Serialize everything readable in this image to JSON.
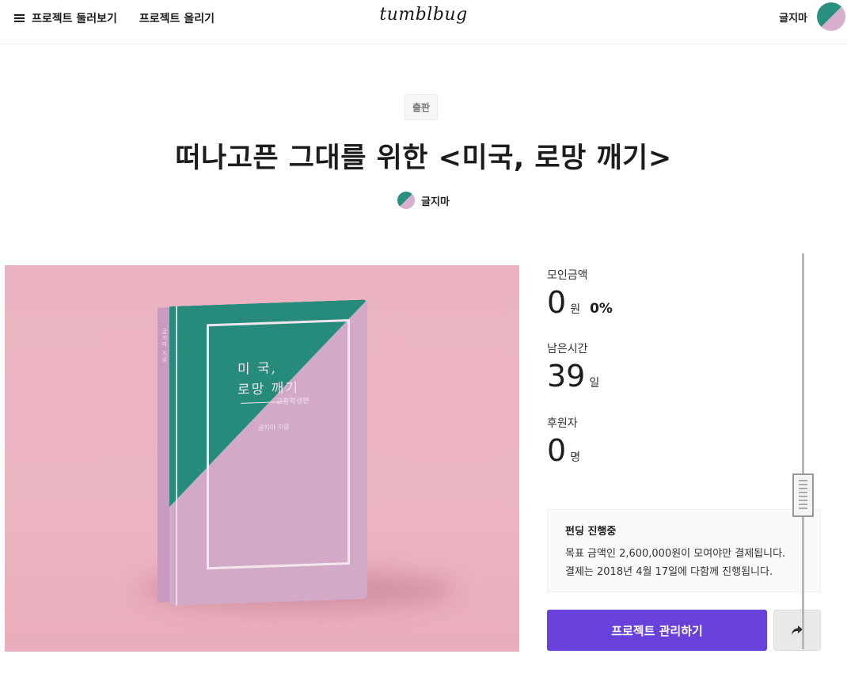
{
  "header": {
    "nav_browse": "프로젝트 둘러보기",
    "nav_upload": "프로젝트 올리기",
    "logo": "tumblbug",
    "user_name": "글지마"
  },
  "project": {
    "category": "출판",
    "title": "떠나고픈 그대를 위한 <미국, 로망 깨기>",
    "creator": "글지마"
  },
  "book_cover": {
    "line1": "미  국,",
    "line2": "로망 깨기",
    "subtitle": "교환학생편",
    "author": "글지마 지음"
  },
  "stats": {
    "funded_label": "모인금액",
    "funded_value": "0",
    "funded_unit": "원",
    "funded_percent": "0%",
    "time_label": "남은시간",
    "time_value": "39",
    "time_unit": "일",
    "backers_label": "후원자",
    "backers_value": "0",
    "backers_unit": "명"
  },
  "info": {
    "title": "펀딩 진행중",
    "line1": "목표 금액인 2,600,000원이 모여야만 결제됩니다.",
    "line2": "결제는 2018년 4월 17일에 다함께 진행됩니다."
  },
  "actions": {
    "manage_label": "프로젝트 관리하기"
  },
  "colors": {
    "accent": "#6741d9",
    "cover_teal": "#268b7b",
    "cover_pink": "#d2aac8",
    "background_pink": "#ebb3c1"
  }
}
